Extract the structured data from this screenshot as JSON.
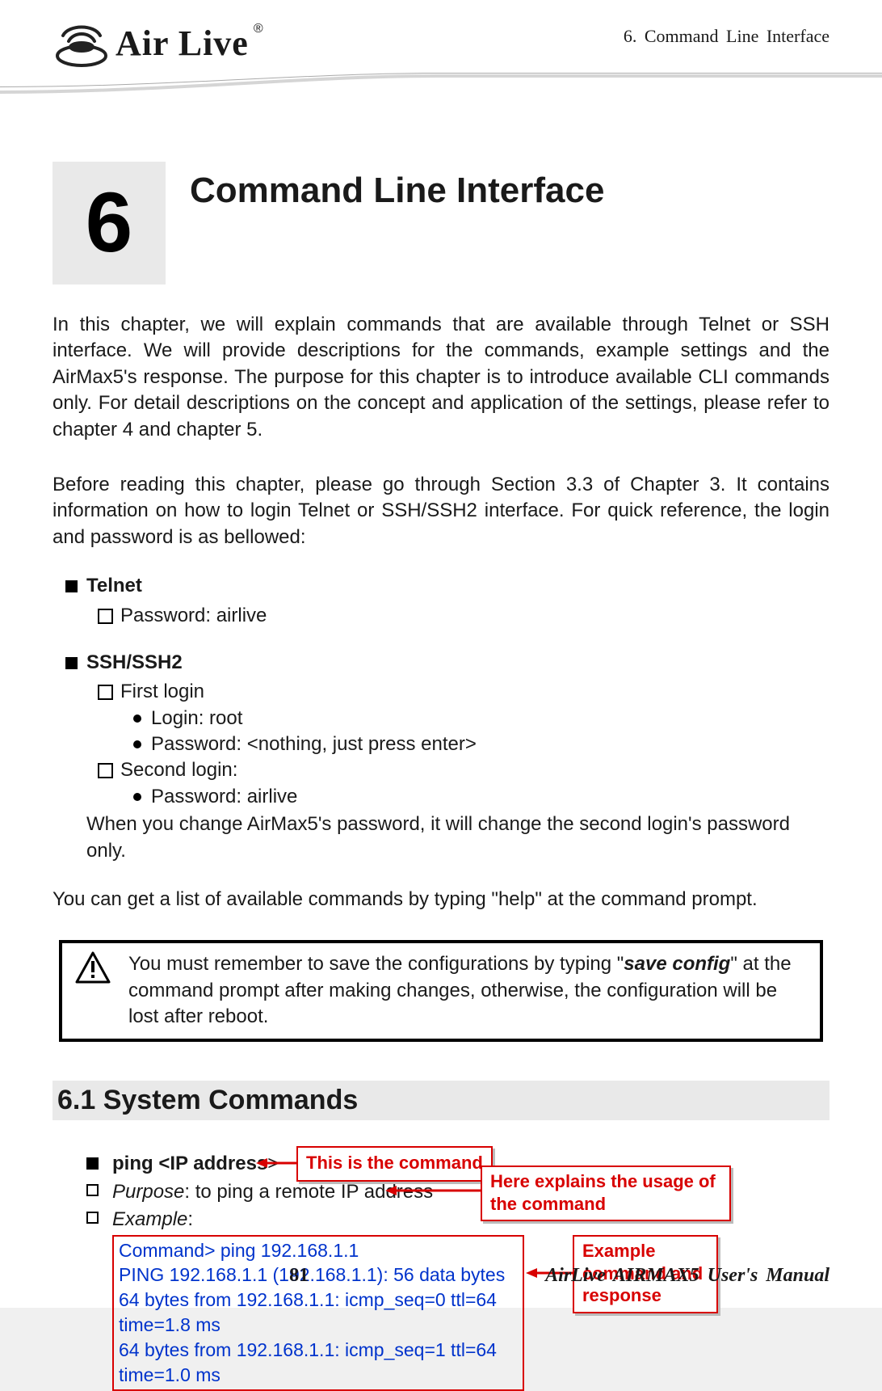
{
  "header": {
    "running_title": "6.    Command  Line  Interface",
    "logo_text": "Air Live"
  },
  "chapter": {
    "number": "6",
    "title": "Command Line Interface"
  },
  "intro_para": "In this chapter, we will explain commands that are available through Telnet or SSH interface.   We will provide descriptions for the commands, example settings and the AirMax5's response.    The purpose for this chapter is to introduce available CLI commands only.    For detail descriptions on the concept and application of the settings, please refer to chapter 4 and chapter 5.",
  "before_para": "Before reading this chapter, please go through Section 3.3 of Chapter 3.    It contains information on how to login Telnet or SSH/SSH2 interface.    For quick reference, the login and password is as bellowed:",
  "telnet": {
    "label": "Telnet",
    "items": [
      "Password: airlive"
    ]
  },
  "ssh": {
    "label": "SSH/SSH2",
    "first_login": {
      "label": "First login",
      "items": [
        "Login: root",
        "Password: <nothing, just press enter>"
      ]
    },
    "second_login": {
      "label": "Second login:",
      "items": [
        "Password: airlive"
      ]
    },
    "note": "When you change AirMax5's password, it will change the second login's password only."
  },
  "help_line": "You can get a list of available commands by typing \"help\" at the command prompt.",
  "warning": {
    "pre": "You must remember to save the configurations by typing \"",
    "bold1": "save config",
    "post": "\" at the command prompt after making changes, otherwise, the configuration will be lost after reboot."
  },
  "section61": {
    "title": "6.1 System  Commands"
  },
  "ping": {
    "cmd_label": "ping <IP address",
    "angle": ">",
    "purpose_label": "Purpose",
    "purpose_text": ": to ping a remote IP address",
    "example_label": "Example",
    "example_colon": ":",
    "output": [
      "Command> ping 192.168.1.1",
      "PING 192.168.1.1 (192.168.1.1): 56 data bytes",
      "64 bytes from 192.168.1.1: icmp_seq=0 ttl=64 time=1.8 ms",
      "64 bytes from 192.168.1.1: icmp_seq=1 ttl=64 time=1.0 ms"
    ],
    "callouts": {
      "cmd": "This is the command",
      "usage": "Here explains the usage of the command",
      "example": "Example command and response"
    }
  },
  "footer": {
    "page": "81",
    "manual": "AirLive  AIRMAX5  User's  Manual"
  }
}
